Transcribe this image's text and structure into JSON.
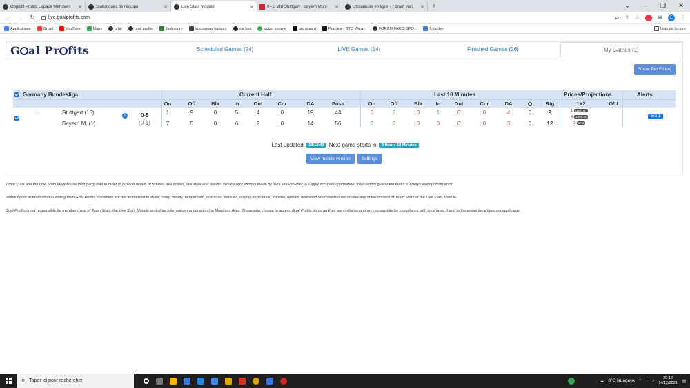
{
  "browser": {
    "tabs": [
      {
        "title": "Objectif Profits Espace Membres",
        "active": false
      },
      {
        "title": "Statistiques de l'équipe",
        "active": false
      },
      {
        "title": "Live Stats Module",
        "active": true
      },
      {
        "title": "0 - 5 VfB Stuttgart - Bayern Muni",
        "active": false
      },
      {
        "title": "Utilisateurs en ligne - Forum Pari",
        "active": false
      }
    ],
    "url": "live.goalprofits.com",
    "bookmarks": [
      "Applications",
      "Gmail",
      "YouTube",
      "Maps",
      "orbit",
      "goal profits",
      "flashscore",
      "soccerway buteurs",
      "cia foot",
      "poker snowie",
      "gto wizard",
      "Practice - GTO Wiza...",
      "FORUM PARIS SPO...",
      "fc tables"
    ],
    "reading_list": "Liste de lecture",
    "profile_initial": "E"
  },
  "site": {
    "logo_text": [
      "G",
      "al Pr",
      "fits"
    ],
    "tabs": [
      "Scheduled Games (24)",
      "LIVE Games (14)",
      "Finished Games (26)",
      "My Games (1)"
    ],
    "pro_filters_button": "Show Pro Filters"
  },
  "table": {
    "league": "Germany Bundesliga",
    "group_headers": {
      "current_half": "Current Half",
      "last10": "Last 10 Minutes",
      "prices": "Prices/Projections",
      "alerts": "Alerts"
    },
    "cols": [
      "On",
      "Off",
      "Blk",
      "In",
      "Out",
      "Cnr",
      "DA",
      "Poss"
    ],
    "cols_last10": [
      "On",
      "Off",
      "Blk",
      "In",
      "Out",
      "Cnr",
      "DA"
    ],
    "rtg_label": "Rtg",
    "price_cols": [
      "1X2",
      "O/U"
    ],
    "match": {
      "time_label": "58",
      "home": "Stuttgart (15)",
      "away": "Bayern M. (1)",
      "score": "0-5",
      "ht_score": "(0-1)",
      "home_current": [
        1,
        9,
        0,
        5,
        4,
        0,
        19,
        44
      ],
      "away_current": [
        7,
        5,
        0,
        6,
        2,
        0,
        14,
        56
      ],
      "home_last10": [
        0,
        2,
        0,
        1,
        0,
        0,
        4
      ],
      "away_last10": [
        2,
        2,
        0,
        0,
        0,
        0,
        3
      ],
      "home_ball": 0,
      "away_ball": 0,
      "home_rtg": 9,
      "away_rtg": 12,
      "odds": [
        {
          "label": "1:",
          "value": "1000.00"
        },
        {
          "label": "X:",
          "value": "1000.00"
        },
        {
          "label": "2:",
          "value": "1.02"
        }
      ],
      "alert": "Set 1"
    }
  },
  "status": {
    "last_updated_label": "Last updated:",
    "last_updated": "19:12:43",
    "next_game_label": "Next game starts in:",
    "next_game": "0 Hours 18 Minutes",
    "mobile_button": "View mobile version",
    "settings_button": "Settings"
  },
  "disclaimers": [
    "Team Stats and the Live Stats Module use third party data in order to provide details of fixtures, live scores, live stats and results. While every effort is made by our Data Provider to supply accurate information, they cannot guarantee that it is always exempt from error.",
    "Without prior authorisation in writing from Goal Profits, members are not authorised to share, copy, modify, tamper with, distribute, transmit, display, reproduce, transfer, upload, download or otherwise use or alter any of the content of Team Stats or the Live Stats Module.",
    "Goal Profits is not responsible for members' use of Team Stats, the Live Stats Module and other information contained in the Members Area. Those who choose to access Goal Profits do so on their own initiative and are responsible for compliance with local laws, if and to the extent local laws are applicable."
  ],
  "taskbar": {
    "search_placeholder": "Taper ici pour rechercher",
    "weather": "8°C Nuageux",
    "time": "20:12",
    "date": "14/12/2021"
  }
}
